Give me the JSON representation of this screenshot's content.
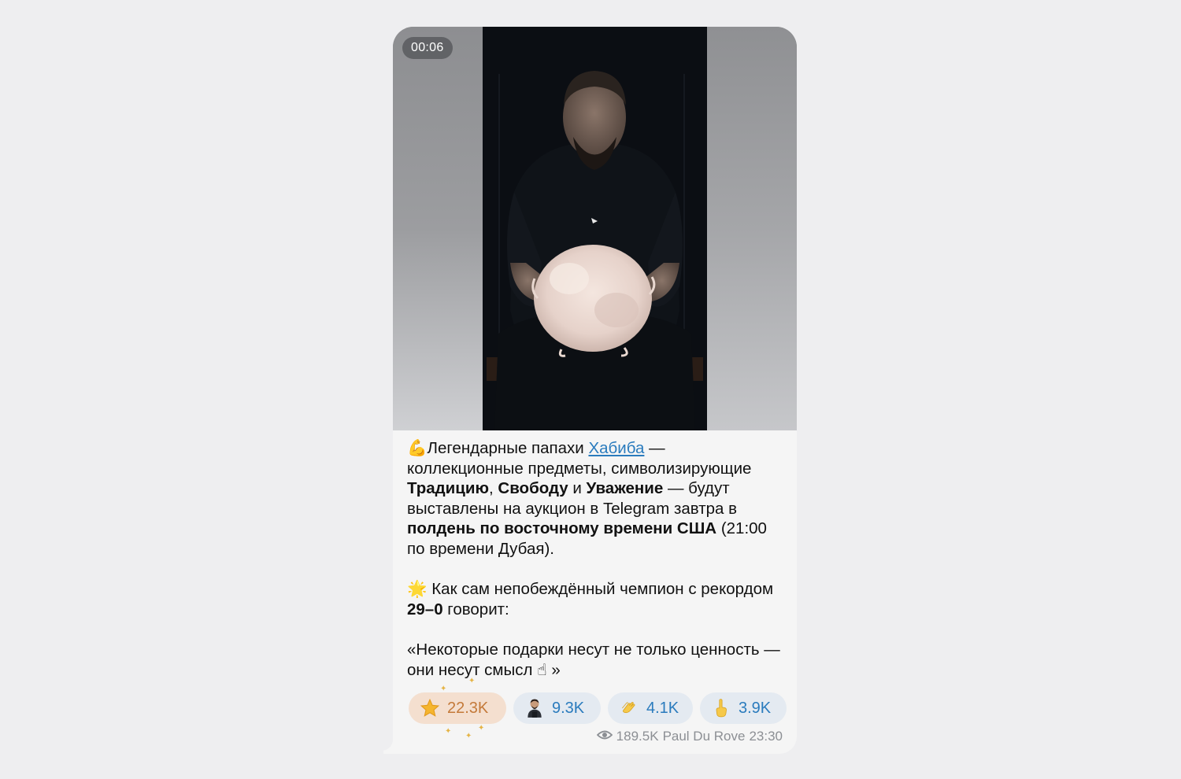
{
  "video": {
    "duration": "00:06"
  },
  "caption": {
    "p1_emoji": "💪",
    "p1_t1": "Легендарные папахи ",
    "p1_link": "Хабиба",
    "p1_t2": " — коллекционные предметы, символизирующие ",
    "p1_b1": "Традицию",
    "p1_t3": ", ",
    "p1_b2": "Свободу",
    "p1_t4": " и ",
    "p1_b3": "Уважение",
    "p1_t5": " — будут выставлены на аукцион в Telegram завтра в ",
    "p1_b4": "полдень по восточному времени США",
    "p1_t6": " (21:00 по времени Дубая).",
    "p2_emoji": "🌟",
    "p2_t1": " Как сам непобеждённый чемпион с рекордом ",
    "p2_b1": "29–0",
    "p2_t2": " говорит:",
    "p3_t1": "«Некоторые подарки несут не только ценность — они несут смысл ",
    "p3_emoji": "☝",
    "p3_t2": " »"
  },
  "reactions": [
    {
      "icon": "star-icon",
      "glyph": "⭐",
      "count": "22.3K"
    },
    {
      "icon": "custom-emoji-icon",
      "glyph": "",
      "count": "9.3K"
    },
    {
      "icon": "clap-icon",
      "glyph": "👏",
      "count": "4.1K"
    },
    {
      "icon": "pointing-up-icon",
      "glyph": "☝",
      "count": "3.9K"
    }
  ],
  "meta": {
    "views": "189.5K",
    "author": "Paul Du Rove",
    "time": "23:30"
  },
  "colors": {
    "bubble": "#f5f5f5",
    "link": "#2a7bbd",
    "reaction_bg": "#e4eaf1",
    "star_reaction_bg": "#f4dfcf",
    "star_reaction_text": "#c47a3a"
  }
}
